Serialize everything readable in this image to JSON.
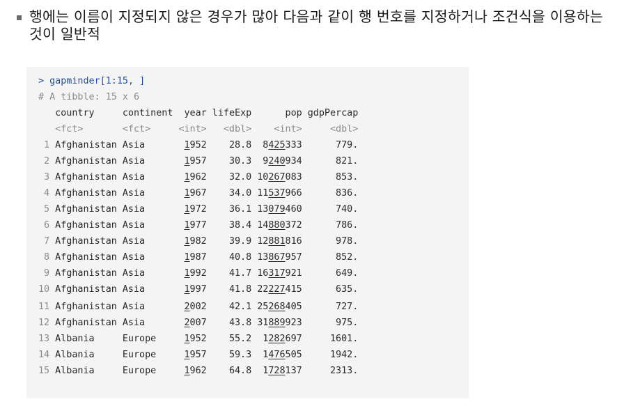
{
  "bullet_text": "행에는 이름이 지정되지 않은 경우가 많아 다음과 같이 행 번호를 지정하거나 조건식을 이용하는 것이 일반적",
  "console": {
    "prompt": "> gapminder[1:15, ]",
    "comment": "# A tibble: 15 x 6",
    "headers": [
      "country",
      "continent",
      "year",
      "lifeExp",
      "pop",
      "gdpPercap"
    ],
    "types": [
      "<fct>",
      "<fct>",
      "<int>",
      "<dbl>",
      "<int>",
      "<dbl>"
    ],
    "rows": [
      {
        "n": "1",
        "country": "Afghanistan",
        "continent": "Asia",
        "year": "1952",
        "lifeExp": "28.8",
        "pop": "8425333",
        "gdp": "779."
      },
      {
        "n": "2",
        "country": "Afghanistan",
        "continent": "Asia",
        "year": "1957",
        "lifeExp": "30.3",
        "pop": "9240934",
        "gdp": "821."
      },
      {
        "n": "3",
        "country": "Afghanistan",
        "continent": "Asia",
        "year": "1962",
        "lifeExp": "32.0",
        "pop": "10267083",
        "gdp": "853."
      },
      {
        "n": "4",
        "country": "Afghanistan",
        "continent": "Asia",
        "year": "1967",
        "lifeExp": "34.0",
        "pop": "11537966",
        "gdp": "836."
      },
      {
        "n": "5",
        "country": "Afghanistan",
        "continent": "Asia",
        "year": "1972",
        "lifeExp": "36.1",
        "pop": "13079460",
        "gdp": "740."
      },
      {
        "n": "6",
        "country": "Afghanistan",
        "continent": "Asia",
        "year": "1977",
        "lifeExp": "38.4",
        "pop": "14880372",
        "gdp": "786."
      },
      {
        "n": "7",
        "country": "Afghanistan",
        "continent": "Asia",
        "year": "1982",
        "lifeExp": "39.9",
        "pop": "12881816",
        "gdp": "978."
      },
      {
        "n": "8",
        "country": "Afghanistan",
        "continent": "Asia",
        "year": "1987",
        "lifeExp": "40.8",
        "pop": "13867957",
        "gdp": "852."
      },
      {
        "n": "9",
        "country": "Afghanistan",
        "continent": "Asia",
        "year": "1992",
        "lifeExp": "41.7",
        "pop": "16317921",
        "gdp": "649."
      },
      {
        "n": "10",
        "country": "Afghanistan",
        "continent": "Asia",
        "year": "1997",
        "lifeExp": "41.8",
        "pop": "22227415",
        "gdp": "635."
      },
      {
        "n": "11",
        "country": "Afghanistan",
        "continent": "Asia",
        "year": "2002",
        "lifeExp": "42.1",
        "pop": "25268405",
        "gdp": "727."
      },
      {
        "n": "12",
        "country": "Afghanistan",
        "continent": "Asia",
        "year": "2007",
        "lifeExp": "43.8",
        "pop": "31889923",
        "gdp": "975."
      },
      {
        "n": "13",
        "country": "Albania",
        "continent": "Europe",
        "year": "1952",
        "lifeExp": "55.2",
        "pop": "1282697",
        "gdp": "1601."
      },
      {
        "n": "14",
        "country": "Albania",
        "continent": "Europe",
        "year": "1957",
        "lifeExp": "59.3",
        "pop": "1476505",
        "gdp": "1942."
      },
      {
        "n": "15",
        "country": "Albania",
        "continent": "Europe",
        "year": "1962",
        "lifeExp": "64.8",
        "pop": "1728137",
        "gdp": "2313."
      }
    ]
  }
}
